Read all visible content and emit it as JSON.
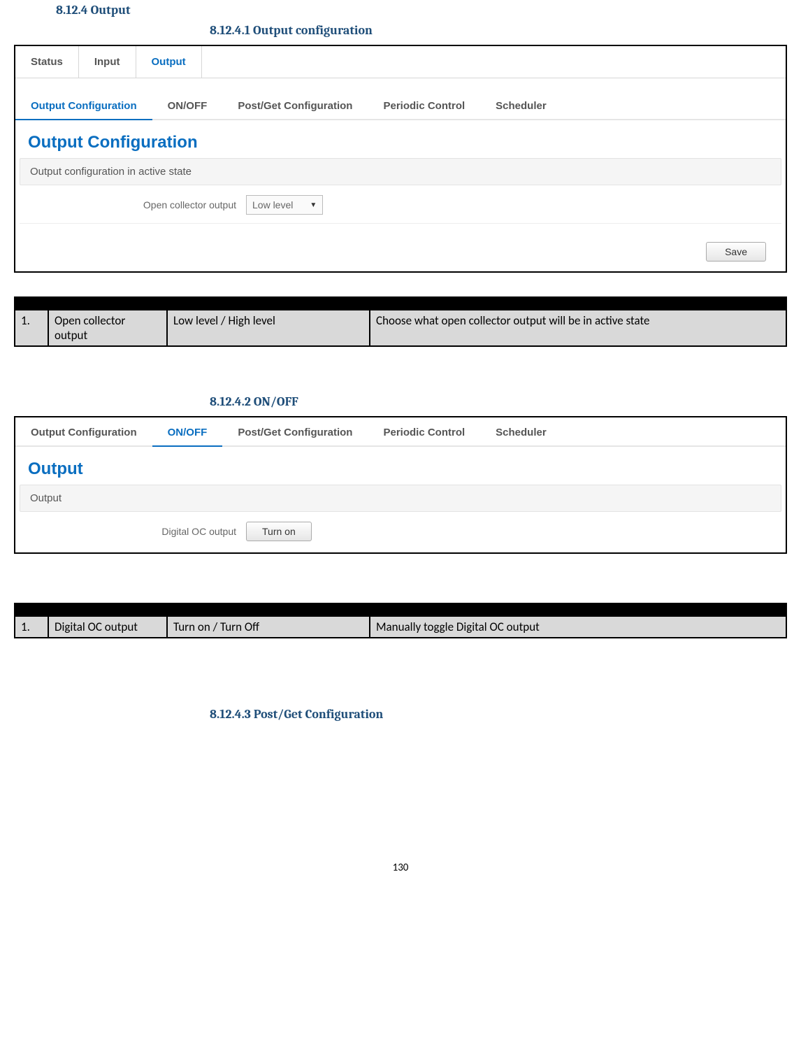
{
  "sec": {
    "h3": "8.12.4 Output",
    "h4a": "8.12.4.1 Output configuration",
    "h4b": "8.12.4.2 ON/OFF",
    "h4c": "8.12.4.3 Post/Get Configuration"
  },
  "shot1": {
    "toptabs": {
      "status": "Status",
      "input": "Input",
      "output": "Output"
    },
    "subtabs": {
      "cfg": "Output Configuration",
      "onoff": "ON/OFF",
      "postget": "Post/Get Configuration",
      "periodic": "Periodic Control",
      "sched": "Scheduler"
    },
    "title": "Output Configuration",
    "legend": "Output configuration in active state",
    "field_label": "Open collector output",
    "field_value": "Low level",
    "save": "Save"
  },
  "table1": {
    "rows": [
      {
        "n": "1.",
        "name": "Open collector output",
        "val": "Low level / High level",
        "exp": "Choose what open collector output will be in active state"
      }
    ]
  },
  "shot2": {
    "subtabs": {
      "cfg": "Output Configuration",
      "onoff": "ON/OFF",
      "postget": "Post/Get Configuration",
      "periodic": "Periodic Control",
      "sched": "Scheduler"
    },
    "title": "Output",
    "legend": "Output",
    "field_label": "Digital OC output",
    "btn": "Turn on"
  },
  "table2": {
    "rows": [
      {
        "n": "1.",
        "name": "Digital OC output",
        "val": "Turn on / Turn Off",
        "exp": "Manually toggle Digital OC output"
      }
    ]
  },
  "pageno": "130"
}
